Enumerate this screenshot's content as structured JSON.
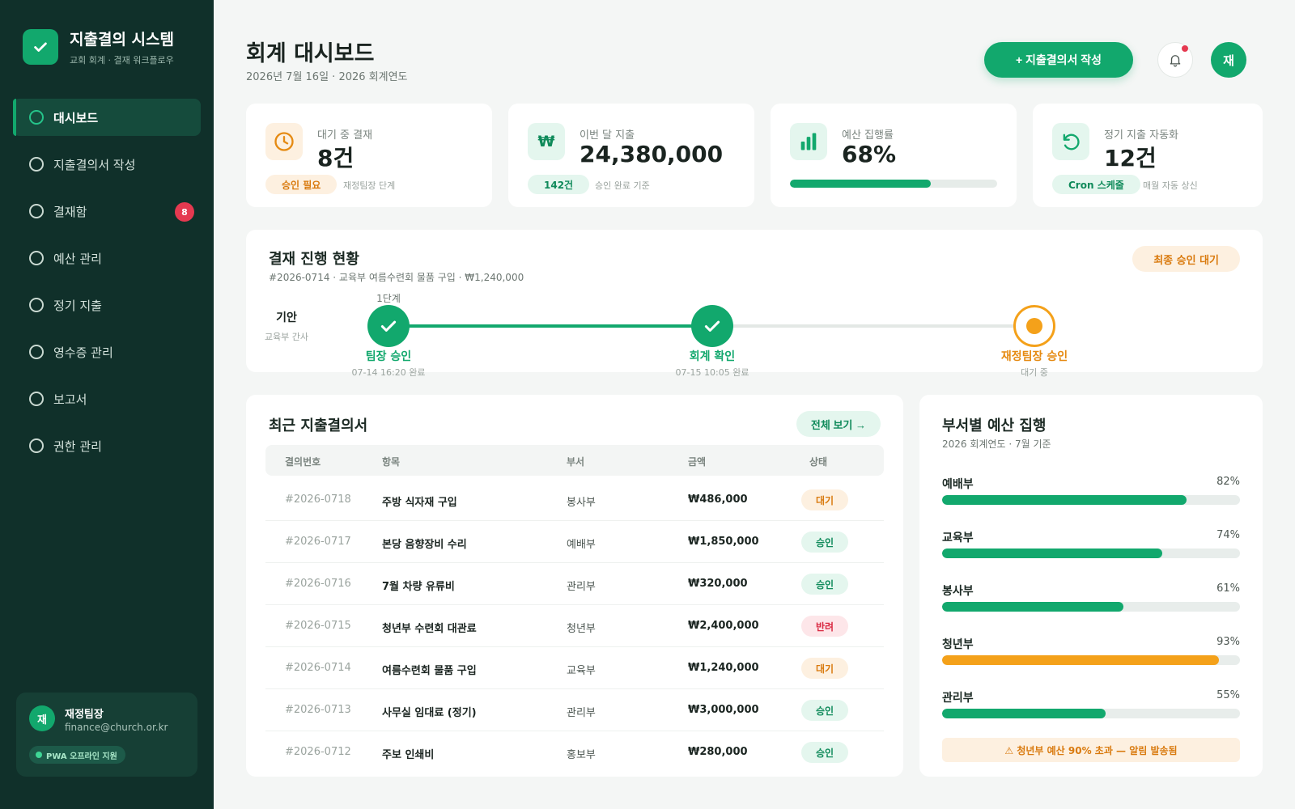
{
  "brand": {
    "title": "지출결의 시스템",
    "subtitle": "교회 회계 · 결재 워크플로우"
  },
  "nav": [
    {
      "label": "대시보드",
      "active": true
    },
    {
      "label": "지출결의서 작성"
    },
    {
      "label": "결재함",
      "badge": "8"
    },
    {
      "label": "예산 관리"
    },
    {
      "label": "정기 지출"
    },
    {
      "label": "영수증 관리"
    },
    {
      "label": "보고서"
    },
    {
      "label": "권한 관리"
    }
  ],
  "user": {
    "initial": "재",
    "name": "재정팀장",
    "email": "finance@church.or.kr",
    "pwa": "PWA 오프라인 지원"
  },
  "header": {
    "title": "회계 대시보드",
    "subtitle": "2026년 7월 16일 · 2026 회계연도",
    "new_button": "+ 지출결의서 작성",
    "avatar": "재"
  },
  "stats": {
    "pending": {
      "label": "대기 중 결재",
      "value": "8건",
      "pill": "승인 필요",
      "note": "재정팀장 단계"
    },
    "spend": {
      "icon": "₩",
      "label": "이번 달 지출",
      "value": "24,380,000",
      "pill": "142건",
      "note": "승인 완료 기준"
    },
    "budget": {
      "label": "예산 집행률",
      "value": "68%",
      "progress": 68
    },
    "recurring": {
      "label": "정기 지출 자동화",
      "value": "12건",
      "pill": "Cron 스케줄",
      "note": "매월 자동 상신"
    }
  },
  "workflow": {
    "title": "결재 진행 현황",
    "subtitle": "#2026-0714 · 교육부 여름수련회 물품 구입 · ₩1,240,000",
    "status_pill": "최종 승인 대기",
    "stage_label": "1단계",
    "draft": {
      "name": "기안",
      "role": "교육부 간사"
    },
    "steps": [
      {
        "name": "팀장 승인",
        "note": "07-14 16:20 완료"
      },
      {
        "name": "회계 확인",
        "note": "07-15 10:05 완료"
      },
      {
        "name": "재정팀장 승인",
        "note": "대기 중"
      }
    ]
  },
  "recent": {
    "title": "최근 지출결의서",
    "view_all": "전체 보기 →",
    "columns": [
      "결의번호",
      "항목",
      "부서",
      "금액",
      "상태"
    ],
    "rows": [
      {
        "id": "#2026-0718",
        "item": "주방 식자재 구입",
        "dept": "봉사부",
        "amount": "₩486,000",
        "status": "대기"
      },
      {
        "id": "#2026-0717",
        "item": "본당 음향장비 수리",
        "dept": "예배부",
        "amount": "₩1,850,000",
        "status": "승인"
      },
      {
        "id": "#2026-0716",
        "item": "7월 차량 유류비",
        "dept": "관리부",
        "amount": "₩320,000",
        "status": "승인"
      },
      {
        "id": "#2026-0715",
        "item": "청년부 수련회 대관료",
        "dept": "청년부",
        "amount": "₩2,400,000",
        "status": "반려"
      },
      {
        "id": "#2026-0714",
        "item": "여름수련회 물품 구입",
        "dept": "교육부",
        "amount": "₩1,240,000",
        "status": "대기"
      },
      {
        "id": "#2026-0713",
        "item": "사무실 임대료 (정기)",
        "dept": "관리부",
        "amount": "₩3,000,000",
        "status": "승인"
      },
      {
        "id": "#2026-0712",
        "item": "주보 인쇄비",
        "dept": "홍보부",
        "amount": "₩280,000",
        "status": "승인"
      }
    ]
  },
  "budget": {
    "title": "부서별 예산 집행",
    "subtitle": "2026 회계연도 · 7월 기준",
    "rows": [
      {
        "name": "예배부",
        "pct": "82%",
        "value": 82
      },
      {
        "name": "교육부",
        "pct": "74%",
        "value": 74
      },
      {
        "name": "봉사부",
        "pct": "61%",
        "value": 61
      },
      {
        "name": "청년부",
        "pct": "93%",
        "value": 93,
        "warn": true
      },
      {
        "name": "관리부",
        "pct": "55%",
        "value": 55
      }
    ],
    "alert": "⚠ 청년부 예산 90% 초과 — 알림 발송됨"
  },
  "colors": {
    "accent": "#12a86d",
    "warning": "#f4a11a",
    "danger": "#e53950",
    "sidebar": "#10302a"
  }
}
